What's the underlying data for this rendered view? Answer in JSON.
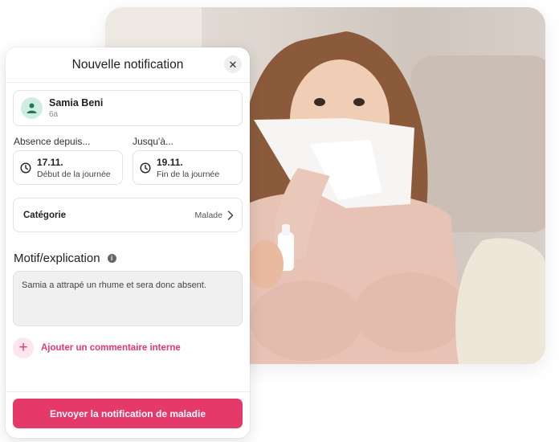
{
  "panel": {
    "title": "Nouvelle notification",
    "close_icon": "close-icon"
  },
  "student": {
    "name": "Samia Beni",
    "class": "6a"
  },
  "absence": {
    "from_label": "Absence depuis...",
    "from_date": "17.11.",
    "from_sub": "Début de la journée",
    "to_label": "Jusqu'à...",
    "to_date": "19.11.",
    "to_sub": "Fin de la journée"
  },
  "category": {
    "label": "Catégorie",
    "value": "Malade"
  },
  "motif": {
    "title": "Motif/explication",
    "text": "Samia a attrapé un rhume et sera donc absent."
  },
  "comment": {
    "add_label": "Ajouter un commentaire interne"
  },
  "submit": {
    "label": "Envoyer la notification de maladie"
  },
  "colors": {
    "accent": "#e5396a",
    "avatar_bg": "#cfeee0"
  }
}
